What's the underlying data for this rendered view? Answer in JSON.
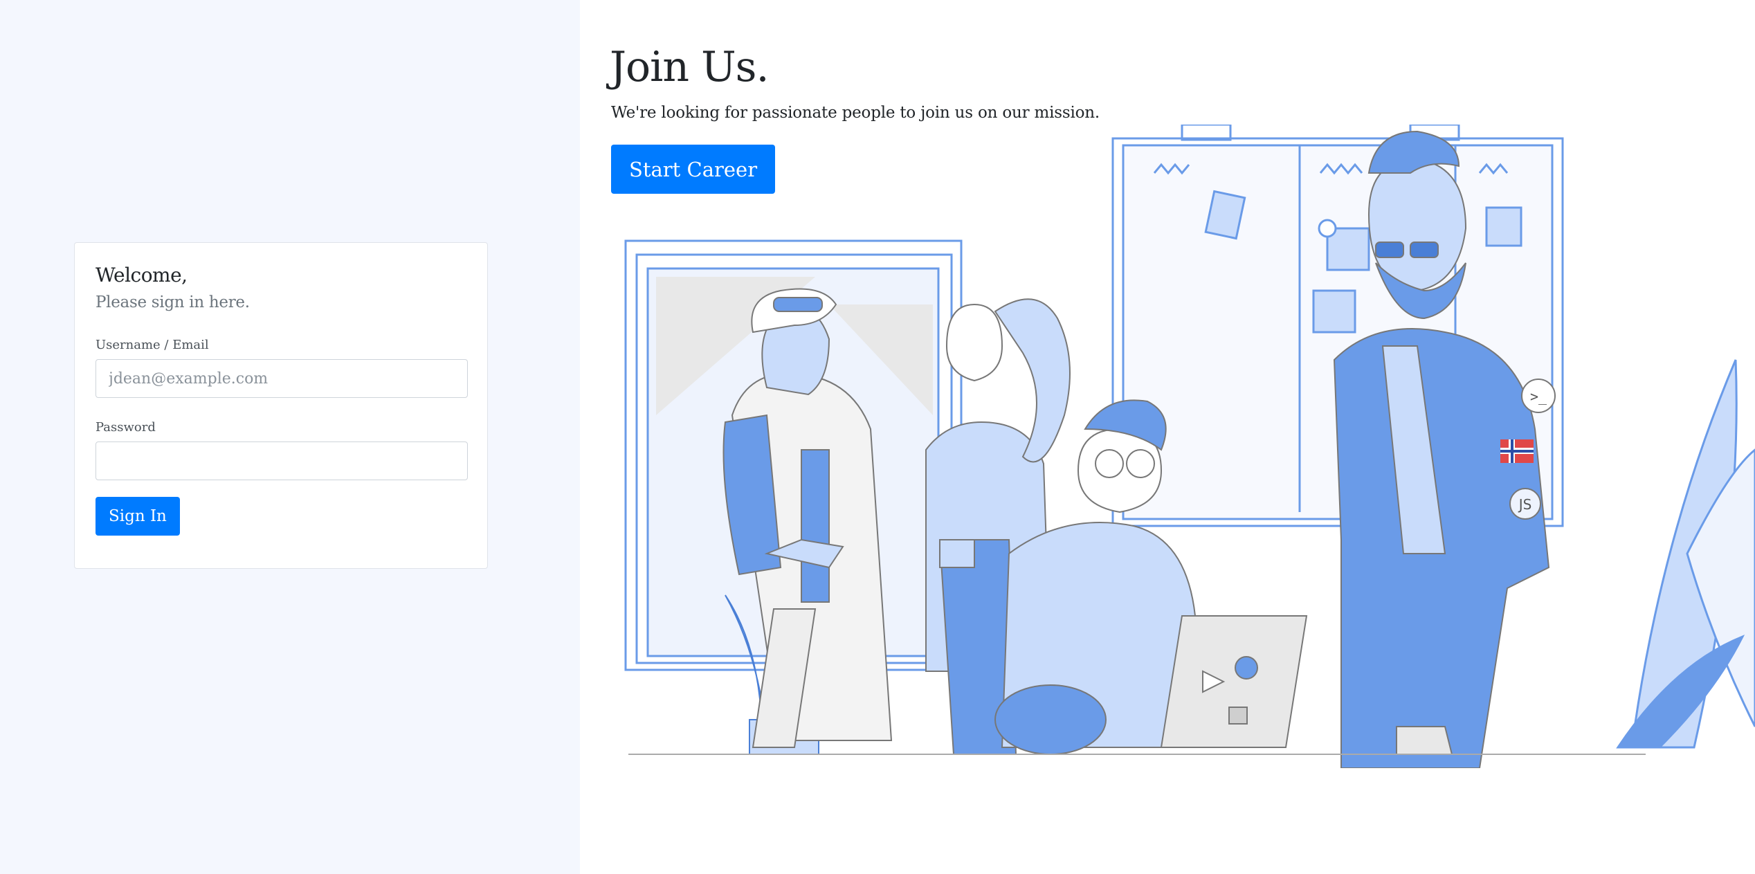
{
  "login": {
    "welcome": "Welcome,",
    "subtitle": "Please sign in here.",
    "username_label": "Username / Email",
    "username_placeholder": "jdean@example.com",
    "username_value": "",
    "password_label": "Password",
    "password_value": "",
    "signin_label": "Sign In"
  },
  "hero": {
    "title": "Join Us.",
    "subtitle": "We're looking for passionate people to join us on our mission.",
    "button_label": "Start Career"
  },
  "illustration": {
    "badge_js": "JS",
    "badge_terminal": ">_"
  },
  "colors": {
    "accent": "#007bff",
    "left_bg": "#f4f7fe",
    "illus_blue": "#6a9be8",
    "illus_light": "#c9dcfb",
    "illus_gray": "#e8e8e8"
  }
}
